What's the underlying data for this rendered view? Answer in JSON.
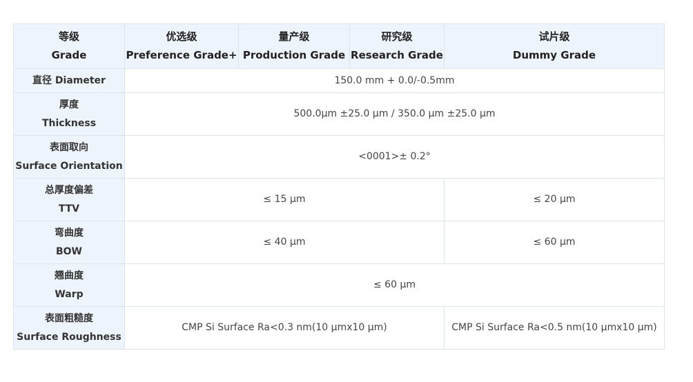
{
  "header": {
    "grade": {
      "zh": "等级",
      "en": "Grade"
    },
    "preference": {
      "zh": "优选级",
      "en": "Preference Grade+"
    },
    "production": {
      "zh": "量产级",
      "en": "Production Grade"
    },
    "research": {
      "zh": "研究级",
      "en": "Research Grade"
    },
    "dummy": {
      "zh": "试片级",
      "en": "Dummy Grade"
    }
  },
  "rows": {
    "diameter": {
      "label": "直径 Diameter",
      "value": "150.0 mm + 0.0/-0.5mm"
    },
    "thickness": {
      "label_zh": "厚度",
      "label_en": "Thickness",
      "value": "500.0μm ±25.0 μm / 350.0 μm ±25.0 μm"
    },
    "orientation": {
      "label_zh": "表面取向",
      "label_en": "Surface Orientation",
      "value": "<0001>± 0.2°"
    },
    "ttv": {
      "label_zh": "总厚度偏差",
      "label_en": "TTV",
      "value_main": "≤ 15 μm",
      "value_dummy": "≤ 20 μm"
    },
    "bow": {
      "label_zh": "弯曲度",
      "label_en": "BOW",
      "value_main": "≤ 40 μm",
      "value_dummy": "≤ 60 μm"
    },
    "warp": {
      "label_zh": "翘曲度",
      "label_en": "Warp",
      "value": "≤ 60 μm"
    },
    "roughness": {
      "label_zh": "表面粗糙度",
      "label_en": "Surface Roughness",
      "value_main": "CMP Si Surface Ra<0.3 nm(10 μmx10 μm)",
      "value_dummy": "CMP Si Surface Ra<0.5 nm(10 μmx10 μm)"
    }
  },
  "colors": {
    "header_bg": "#eef4fb",
    "border": "#dde3ea",
    "text": "#333333"
  }
}
